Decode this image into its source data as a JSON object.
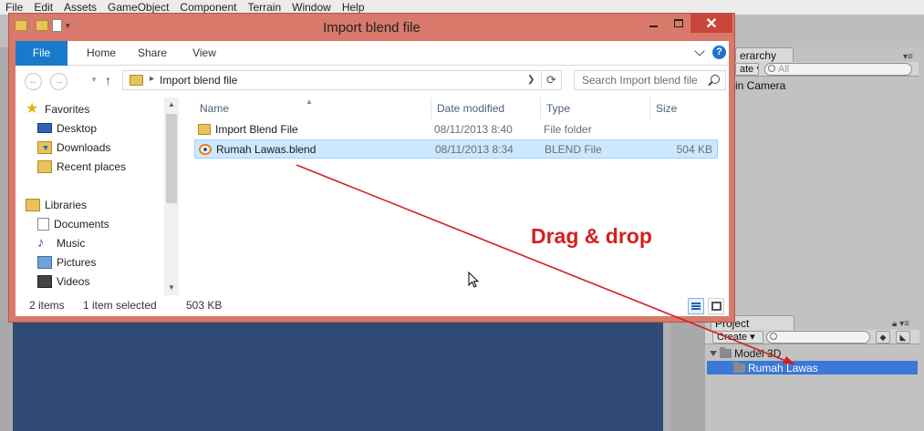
{
  "unity": {
    "menu": [
      "File",
      "Edit",
      "Assets",
      "GameObject",
      "Component",
      "Terrain",
      "Window",
      "Help"
    ],
    "hierarchy": {
      "tab": "Hierarchy",
      "tab_visible": "erarchy",
      "create_label": "Create ▾",
      "create_visible": "ate ▾",
      "search_placeholder": "All",
      "items": [
        "Main Camera"
      ],
      "item_visible": "in Camera"
    },
    "project": {
      "tab": "Project",
      "create_label": "Create ▾",
      "tree": [
        {
          "label": "Model 3D",
          "expanded": true,
          "selected": false
        },
        {
          "label": "Rumah Lawas",
          "selected": true
        }
      ]
    },
    "colors": {
      "scene": "#2f4a76",
      "selection": "#3b78d8"
    }
  },
  "explorer": {
    "title": "Import blend file",
    "ribbon_tabs": [
      "File",
      "Home",
      "Share",
      "View"
    ],
    "nav": {
      "back": "←",
      "forward": "→",
      "up": "↑"
    },
    "address": {
      "crumb": "Import blend file"
    },
    "search": {
      "placeholder": "Search Import blend file"
    },
    "nav_pane": [
      {
        "label": "Favorites",
        "icon": "star-icon",
        "level": 0
      },
      {
        "label": "Desktop",
        "icon": "desktop-icon",
        "level": 1
      },
      {
        "label": "Downloads",
        "icon": "downloads-icon",
        "level": 1
      },
      {
        "label": "Recent places",
        "icon": "recent-places-icon",
        "level": 1
      },
      {
        "label": "Libraries",
        "icon": "libraries-icon",
        "level": 0
      },
      {
        "label": "Documents",
        "icon": "documents-icon",
        "level": 1
      },
      {
        "label": "Music",
        "icon": "music-icon",
        "level": 1
      },
      {
        "label": "Pictures",
        "icon": "pictures-icon",
        "level": 1
      },
      {
        "label": "Videos",
        "icon": "videos-icon",
        "level": 1
      }
    ],
    "columns": [
      "Name",
      "Date modified",
      "Type",
      "Size"
    ],
    "files": [
      {
        "name": "Import Blend File",
        "date": "08/11/2013 8:40",
        "type": "File folder",
        "size": "",
        "icon": "folder-icon",
        "selected": false
      },
      {
        "name": "Rumah Lawas.blend",
        "date": "08/11/2013 8:34",
        "type": "BLEND File",
        "size": "504 KB",
        "icon": "blender-icon",
        "selected": true
      }
    ],
    "status": {
      "count": "2 items",
      "selected": "1 item selected",
      "size": "503 KB"
    },
    "colors": {
      "frame": "#d9796b",
      "close": "#c9473a",
      "file_tab": "#1979ca",
      "selected_row": "#cce8ff"
    }
  },
  "annotation": {
    "text": "Drag & drop",
    "color": "#d3201e"
  }
}
